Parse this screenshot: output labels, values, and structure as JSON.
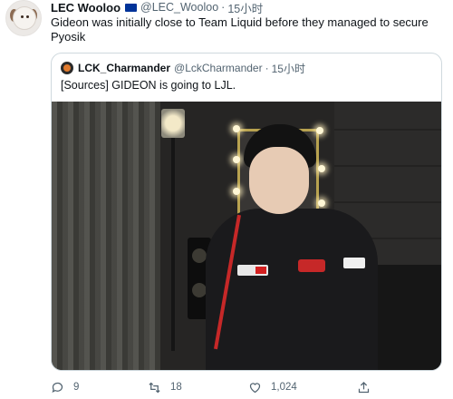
{
  "tweet": {
    "display_name": "LEC Wooloo",
    "handle": "@LEC_Wooloo",
    "separator": "·",
    "time": "15小时",
    "text": "Gideon was initially close to Team Liquid before they managed to secure Pyosik",
    "quoted": {
      "display_name": "LCK_Charmander",
      "handle": "@LckCharmander",
      "separator": "·",
      "time": "15小时",
      "text": "[Sources] GIDEON is going to LJL."
    },
    "actions": {
      "reply_count": "9",
      "retweet_count": "18",
      "like_count": "1,024"
    }
  },
  "icons": {
    "reply": "reply-icon",
    "retweet": "retweet-icon",
    "like": "heart-icon",
    "share": "share-icon",
    "flag": "eu-flag-icon"
  },
  "colors": {
    "text_primary": "#0f1419",
    "text_secondary": "#536471",
    "border": "#cfd9de"
  }
}
